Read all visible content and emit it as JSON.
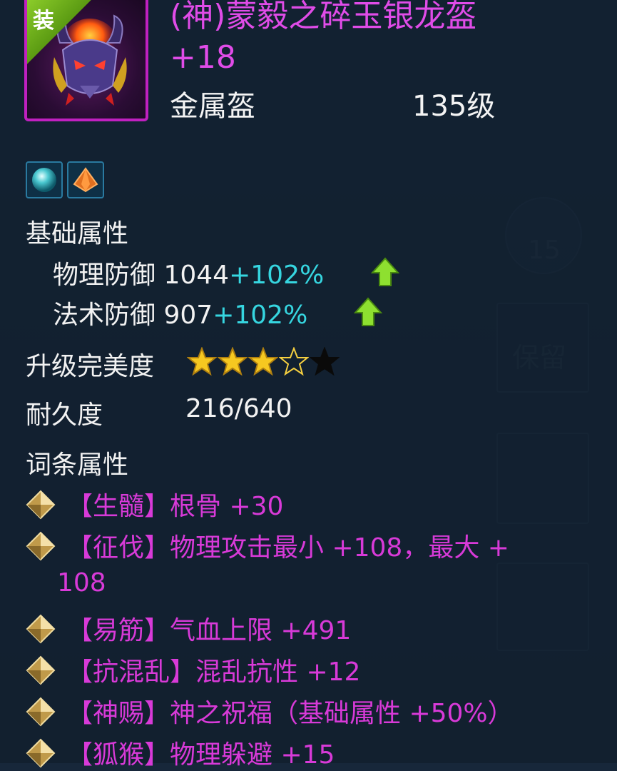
{
  "item": {
    "equip_badge": "装",
    "title": "(神)蒙毅之碎玉银龙盔 +18",
    "type": "金属盔",
    "level": "135级",
    "icon": "demon-helmet-icon"
  },
  "gems": [
    {
      "icon": "cyan-orb-gem-icon"
    },
    {
      "icon": "orange-crystal-gem-icon"
    }
  ],
  "base_attributes": {
    "label": "基础属性",
    "stats": [
      {
        "name": "物理防御",
        "value": "1044",
        "bonus": "+102%",
        "arrow": "green-up-arrow-icon"
      },
      {
        "name": "法术防御",
        "value": "907",
        "bonus": "+102%",
        "arrow": "green-up-arrow-icon"
      }
    ]
  },
  "perfection": {
    "label": "升级完美度",
    "stars_filled": 3,
    "stars_outline": 1,
    "stars_dark": 1,
    "stars_total": 5
  },
  "durability": {
    "label": "耐久度",
    "value": "216/640"
  },
  "affix": {
    "label": "词条属性",
    "items": [
      {
        "text": "【生髓】根骨 +30"
      },
      {
        "text": "【征伐】物理攻击最小 +108，最大 +",
        "continuation": "108"
      },
      {
        "text": "【易筋】气血上限 +491"
      },
      {
        "text": "【抗混乱】混乱抗性 +12"
      },
      {
        "text": "【神赐】神之祝福（基础属性 +50%）"
      },
      {
        "text": "【狐猴】物理躲避 +15"
      }
    ]
  },
  "background": {
    "side_count": "15",
    "keep_label": "保留"
  },
  "colors": {
    "title": "#e04ce8",
    "affix": "#d83ad8",
    "bonus": "#36d6e0",
    "frame": "#c020c0",
    "background": "#17273a"
  }
}
